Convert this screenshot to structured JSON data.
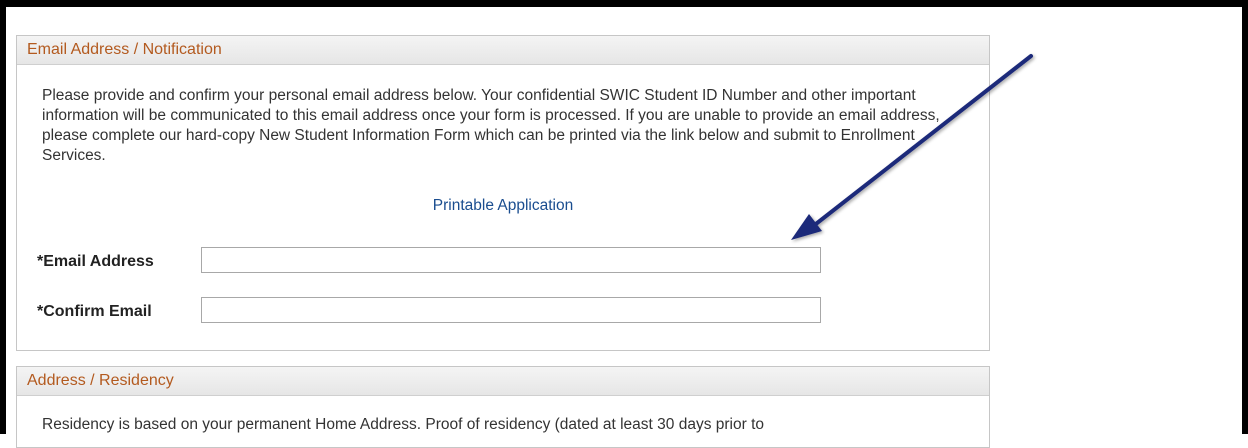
{
  "email_section": {
    "title": "Email Address / Notification",
    "instructions": "Please provide and confirm your personal email address below.  Your confidential SWIC Student ID Number and other important information will be communicated to this email address once your form is processed.  If you are unable to provide an email address, please complete our hard-copy New Student Information Form which can be printed via the link below and submit to Enrollment Services.",
    "printable_link": "Printable Application",
    "email_label": "*Email Address",
    "email_value": "",
    "confirm_label": "*Confirm Email",
    "confirm_value": ""
  },
  "residency_section": {
    "title": "Address / Residency",
    "text": "Residency is based on your permanent Home Address. Proof of residency (dated at least 30 days prior to"
  },
  "annotation": {
    "icon": "pointer-arrow-icon",
    "color": "#1f2a7a"
  },
  "colors": {
    "header_text": "#b35a1f",
    "link": "#1a4d8f"
  }
}
